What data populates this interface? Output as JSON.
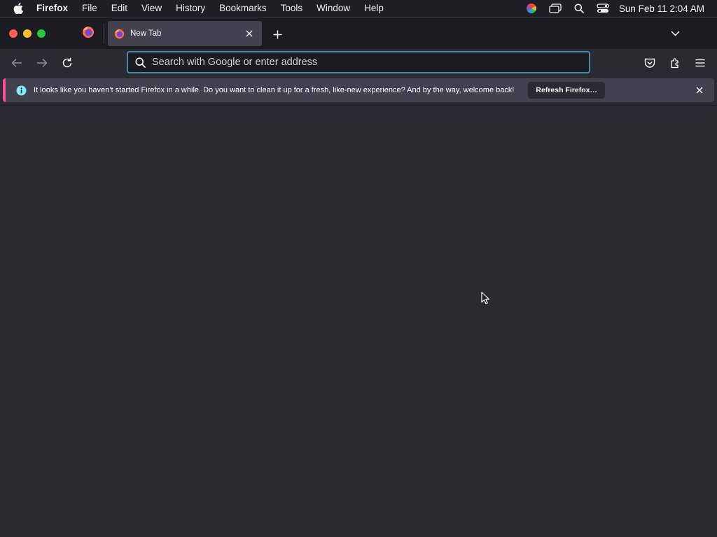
{
  "menubar": {
    "apple_icon": "apple-logo-icon",
    "app_name": "Firefox",
    "items": [
      "File",
      "Edit",
      "View",
      "History",
      "Bookmarks",
      "Tools",
      "Window",
      "Help"
    ],
    "status_icons": [
      "color-wheel-icon",
      "screen-mirroring-icon",
      "spotlight-search-icon",
      "control-center-icon"
    ],
    "clock": "Sun Feb 11  2:04 AM"
  },
  "tabs": {
    "pinned_icon": "firefox-icon",
    "active_tab_title": "New Tab",
    "new_tab_icon": "plus-icon",
    "list_all_tabs_icon": "chevron-down-icon"
  },
  "navbar": {
    "back_icon": "back-arrow-icon",
    "forward_icon": "forward-arrow-icon",
    "reload_icon": "reload-icon",
    "url_placeholder": "Search with Google or enter address",
    "url_value": "",
    "pocket_icon": "pocket-icon",
    "extensions_icon": "extensions-icon",
    "menu_icon": "hamburger-menu-icon"
  },
  "notification": {
    "message": "It looks like you haven’t started Firefox in a while. Do you want to clean it up for a fresh, like-new experience? And by the way, welcome back!",
    "button_label": "Refresh Firefox…",
    "accent_color": "#ff4aa2",
    "info_color": "#80ebff"
  },
  "colors": {
    "urlbar_focus": "#3b8fb0",
    "tab_active": "#42414d",
    "background": "#2b2a33"
  }
}
